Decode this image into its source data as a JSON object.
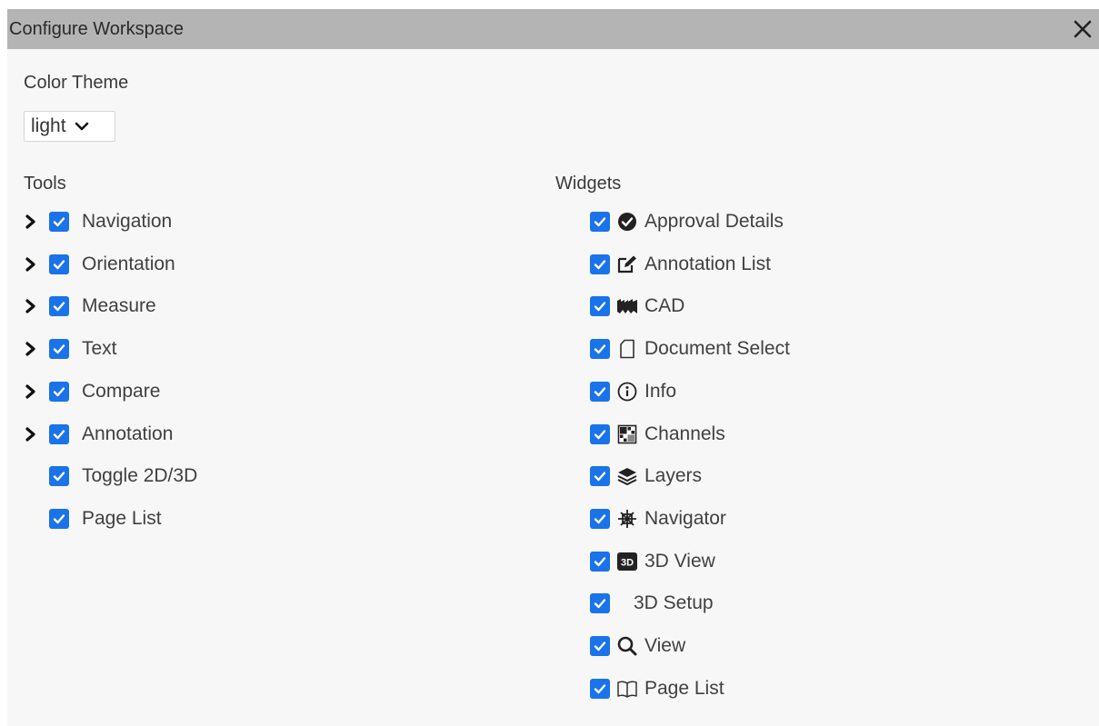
{
  "dialog": {
    "title": "Configure Workspace"
  },
  "color_theme": {
    "label": "Color Theme",
    "selected": "light"
  },
  "tools": {
    "header": "Tools",
    "items": [
      {
        "label": "Navigation",
        "expandable": true,
        "checked": true
      },
      {
        "label": "Orientation",
        "expandable": true,
        "checked": true
      },
      {
        "label": "Measure",
        "expandable": true,
        "checked": true
      },
      {
        "label": "Text",
        "expandable": true,
        "checked": true
      },
      {
        "label": "Compare",
        "expandable": true,
        "checked": true
      },
      {
        "label": "Annotation",
        "expandable": true,
        "checked": true
      },
      {
        "label": "Toggle 2D/3D",
        "expandable": false,
        "checked": true
      },
      {
        "label": "Page List",
        "expandable": false,
        "checked": true
      }
    ]
  },
  "widgets": {
    "header": "Widgets",
    "items": [
      {
        "label": "Approval Details",
        "icon": "check-circle-icon",
        "checked": true
      },
      {
        "label": "Annotation List",
        "icon": "edit-icon",
        "checked": true
      },
      {
        "label": "CAD",
        "icon": "cad-icon",
        "checked": true
      },
      {
        "label": "Document Select",
        "icon": "document-icon",
        "checked": true
      },
      {
        "label": "Info",
        "icon": "info-icon",
        "checked": true
      },
      {
        "label": "Channels",
        "icon": "channels-icon",
        "checked": true
      },
      {
        "label": "Layers",
        "icon": "layers-icon",
        "checked": true
      },
      {
        "label": "Navigator",
        "icon": "navigator-icon",
        "checked": true
      },
      {
        "label": "3D View",
        "icon": "3d-icon",
        "checked": true
      },
      {
        "label": "3D Setup",
        "icon": "",
        "checked": true
      },
      {
        "label": "View",
        "icon": "search-icon",
        "checked": true
      },
      {
        "label": "Page List",
        "icon": "book-icon",
        "checked": true
      }
    ]
  },
  "colors": {
    "titlebar": "#b4b4b4",
    "panel": "#f7f7f7",
    "checkbox": "#1a73e8"
  }
}
